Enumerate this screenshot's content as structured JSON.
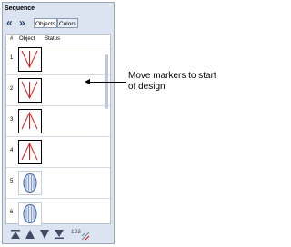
{
  "window": {
    "title": "Sequence"
  },
  "toolbar": {
    "prev_glyph": "«",
    "next_glyph": "»",
    "tabs": [
      "Objects",
      "Colors"
    ]
  },
  "columns": [
    "#",
    "Object",
    "Status"
  ],
  "rows": [
    {
      "num": "1",
      "thumb": "v-arrow-down"
    },
    {
      "num": "2",
      "thumb": "v-arrow-down"
    },
    {
      "num": "3",
      "thumb": "v-arrow-up"
    },
    {
      "num": "4",
      "thumb": "v-arrow-up"
    },
    {
      "num": "5",
      "thumb": "oval-fill"
    },
    {
      "num": "6",
      "thumb": "oval-fill"
    }
  ],
  "bottom_toolbar": {
    "icons": [
      "move-to-start-icon",
      "move-up-icon",
      "move-down-icon",
      "move-to-end-icon",
      "sequence-numbers-icon"
    ],
    "number_label": "123"
  },
  "annotation": {
    "text": "Move markers to start of design"
  },
  "colors": {
    "stitch": "#d41b1b",
    "oval_blue": "#4a6fb5",
    "panel_bg": "#dbe4f0"
  }
}
